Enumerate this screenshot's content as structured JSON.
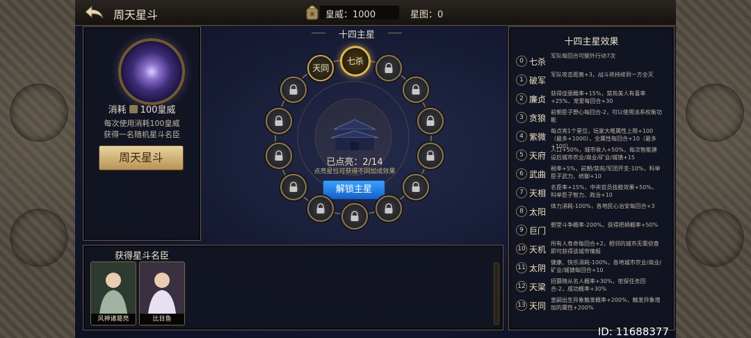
{
  "header": {
    "title": "周天星斗",
    "resource_label": "皇威：1000",
    "star_label": "星图：0"
  },
  "left_panel": {
    "cost_prefix": "消耗",
    "cost_value": "100皇威",
    "desc_line1": "每次使用消耗100皇威",
    "desc_line2": "获得一名随机星斗名臣",
    "button": "周天星斗"
  },
  "center": {
    "title": "十四主星",
    "nodes": [
      {
        "label": "七杀",
        "state": "active"
      },
      {
        "label": "",
        "state": "locked"
      },
      {
        "label": "",
        "state": "locked"
      },
      {
        "label": "",
        "state": "locked"
      },
      {
        "label": "",
        "state": "locked"
      },
      {
        "label": "",
        "state": "locked"
      },
      {
        "label": "",
        "state": "locked"
      },
      {
        "label": "",
        "state": "locked"
      },
      {
        "label": "",
        "state": "locked"
      },
      {
        "label": "",
        "state": "locked"
      },
      {
        "label": "",
        "state": "locked"
      },
      {
        "label": "",
        "state": "locked"
      },
      {
        "label": "",
        "state": "locked"
      },
      {
        "label": "天同",
        "state": "lit"
      }
    ],
    "lit_text": "已点亮：2/14",
    "tip": "点亮星位可获得不同加成效果",
    "unlock_button": "解锁主星",
    "lock_icon": "lock-icon"
  },
  "effects": {
    "title": "十四主星效果",
    "items": [
      {
        "num": "0",
        "name": "七杀",
        "effect": "军队每回合可额外行动7次"
      },
      {
        "num": "1",
        "name": "破军",
        "effect": "军队攻击距离+3，战斗将持续到一方全灭"
      },
      {
        "num": "2",
        "name": "廉贞",
        "effect": "获得佳丽概率+15%，禁苑美人有喜率+25%，宠爱每回合+30"
      },
      {
        "num": "3",
        "name": "贪狼",
        "effect": "前朝臣子野心每回合-2，可以使用派系权衡功能"
      },
      {
        "num": "4",
        "name": "紫微",
        "effect": "每点亮1个星位，玩家大唯属性上限+100（最多+1000），全属性每回合+10（最多+100）"
      },
      {
        "num": "5",
        "name": "天府",
        "effect": "人口+50%，城市收入+50%，每次智能建设后城市农业/商业/矿业/城镇+15"
      },
      {
        "num": "6",
        "name": "武曲",
        "effect": "税率+5%，前朝/禁苑/军团开支-10%，科举臣子武力、统御+10"
      },
      {
        "num": "7",
        "name": "天相",
        "effect": "名臣率+15%，中央官员技能效果+50%，科举臣子智力、政治+10"
      },
      {
        "num": "8",
        "name": "太阳",
        "effect": "体力消耗-100%，各地民心治安每回合+3"
      },
      {
        "num": "9",
        "name": "巨门",
        "effect": "朝堂斗争概率-200%，获得把柄概率+50%"
      },
      {
        "num": "10",
        "name": "天机",
        "effect": "所有人寿命每回合+2，相邻的城市无需侦查即可获得该城市情报"
      },
      {
        "num": "11",
        "name": "太阴",
        "effect": "健康、快乐消耗-100%，各地城市农业/商业/矿业/城镇每回合+10"
      },
      {
        "num": "12",
        "name": "天梁",
        "effect": "招募随从名人概率+30%，密探任务回合-2，成功概率+30%"
      },
      {
        "num": "13",
        "name": "天同",
        "effect": "皇嗣出生异象触发概率+200%，触发异象增加的属性+200%"
      }
    ]
  },
  "bottom": {
    "title": "获得星斗名臣",
    "cards": [
      {
        "name": "风神诸葛亮"
      },
      {
        "name": "比目鱼"
      }
    ]
  },
  "footer": {
    "id": "ID: 11688377"
  }
}
